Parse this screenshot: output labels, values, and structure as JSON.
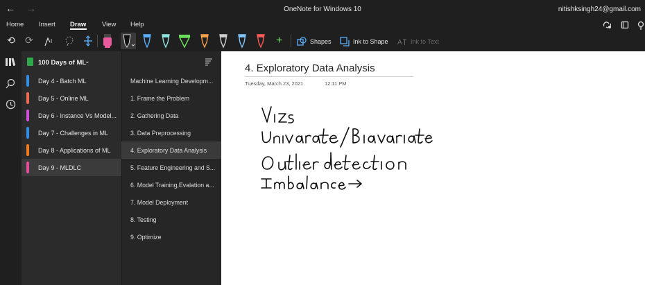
{
  "titlebar": {
    "back_icon": "←",
    "forward_icon": "→",
    "title": "OneNote for Windows 10",
    "user": "nitishksingh24@gmail.com"
  },
  "menu": {
    "items": [
      "Home",
      "Insert",
      "Draw",
      "View",
      "Help"
    ],
    "active": "Draw",
    "right_icons": [
      "sync-icon",
      "notebook-icon",
      "lightbulb-icon"
    ]
  },
  "toolbar": {
    "undo_icon": "⟲",
    "redo_icon": "⟳",
    "shapes_label": "Shapes",
    "ink_to_shape_label": "Ink to Shape",
    "ink_to_text_label": "Ink to Text",
    "add_pen_icon": "+",
    "pens": [
      {
        "name": "highlighter-pink",
        "color": "#e85a9b"
      },
      {
        "name": "pen-black-selected",
        "color": "#111111"
      },
      {
        "name": "pen-blue",
        "color": "#5ab0ff"
      },
      {
        "name": "pen-teal",
        "color": "#8fe3e0"
      },
      {
        "name": "highlighter-green",
        "color": "#6be05a"
      },
      {
        "name": "pen-orange",
        "color": "#f5a04c"
      },
      {
        "name": "pen-grey",
        "color": "#cfcfcf"
      },
      {
        "name": "pen-lightblue",
        "color": "#7fc6ff"
      },
      {
        "name": "pen-red",
        "color": "#ff5a5a"
      }
    ]
  },
  "notebook": {
    "title": "100 Days of ML",
    "color": "#2ea84a"
  },
  "sections": [
    {
      "label": "Day 4 - Batch ML",
      "color": "#2e8ee8",
      "selected": false
    },
    {
      "label": "Day 5 - Online ML",
      "color": "#ef6a4f",
      "selected": false
    },
    {
      "label": "Day 6 - Instance Vs Model...",
      "color": "#d44fd9",
      "selected": false
    },
    {
      "label": "Day 7 - Challenges in ML",
      "color": "#2e8ee8",
      "selected": false
    },
    {
      "label": "Day 8 - Applications of ML",
      "color": "#f07b1e",
      "selected": false
    },
    {
      "label": "Day 9 - MLDLC",
      "color": "#e64a9a",
      "selected": true
    }
  ],
  "pages": [
    {
      "label": "Machine Learning Developm...",
      "selected": false
    },
    {
      "label": "1. Frame the Problem",
      "selected": false
    },
    {
      "label": "2. Gathering Data",
      "selected": false
    },
    {
      "label": "3. Data Preprocessing",
      "selected": false
    },
    {
      "label": "4. Exploratory Data Analysis",
      "selected": true
    },
    {
      "label": "5. Feature Engineering and S...",
      "selected": false
    },
    {
      "label": "6. Model Training,Evalation a...",
      "selected": false
    },
    {
      "label": "7. Model Deployment",
      "selected": false
    },
    {
      "label": "8. Testing",
      "selected": false
    },
    {
      "label": "9. Optimize",
      "selected": false
    }
  ],
  "page": {
    "title": "4. Exploratory Data Analysis",
    "date": "Tuesday, March 23, 2021",
    "time": "12:11 PM"
  },
  "ink_notes": [
    "Vizs",
    "Univariate/Biavariate",
    "Outlier detection",
    "Imbalance →"
  ]
}
